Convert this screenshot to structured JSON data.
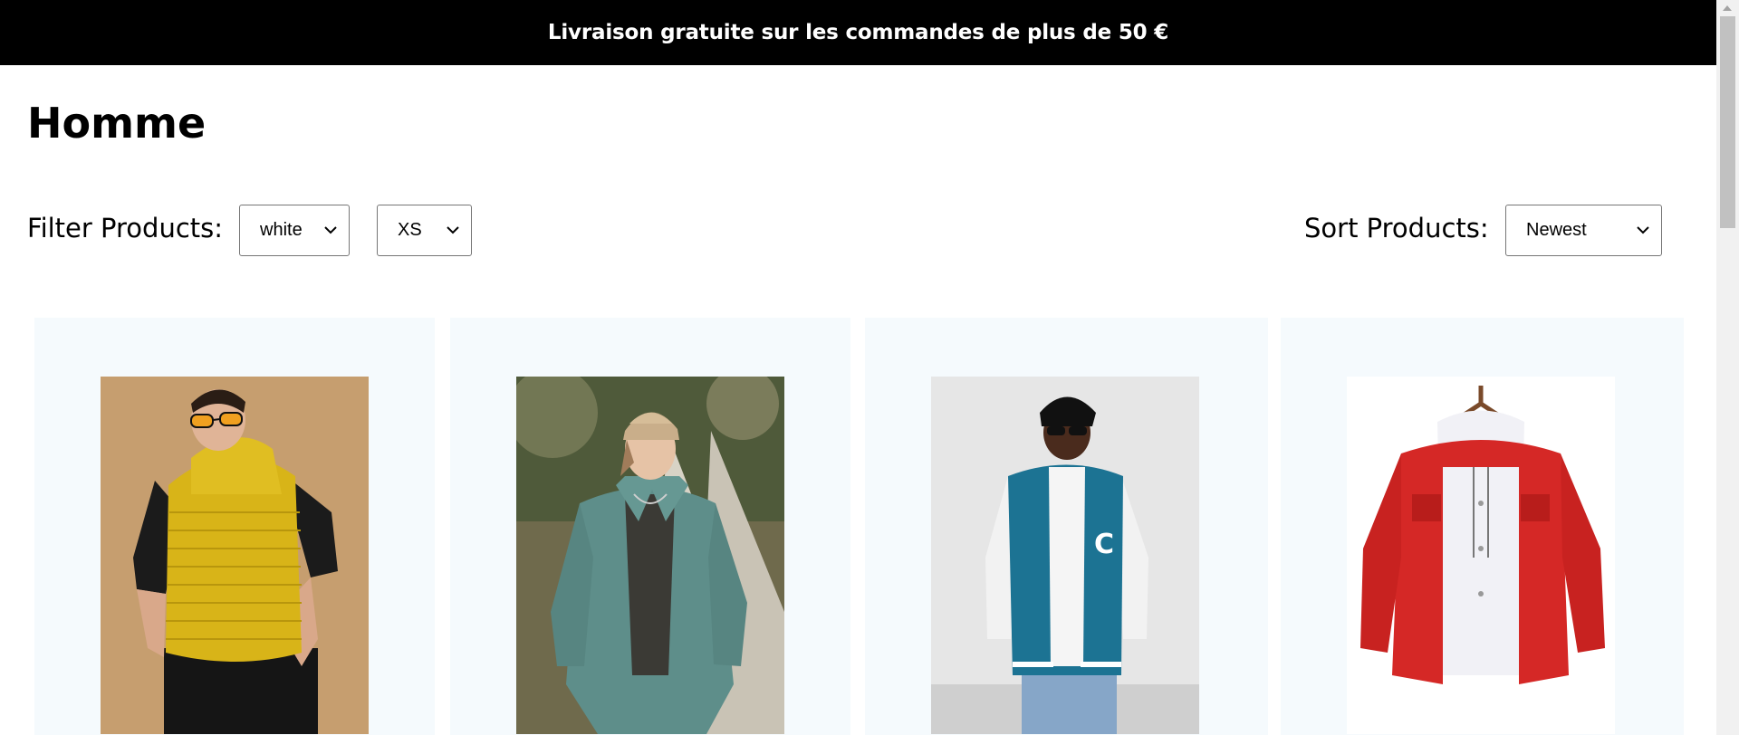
{
  "announcement": {
    "text": "Livraison gratuite sur les commandes de plus de 50 €"
  },
  "page": {
    "title": "Homme"
  },
  "filters": {
    "label": "Filter Products:",
    "color_selected": "white",
    "size_selected": "XS"
  },
  "sort": {
    "label": "Sort Products:",
    "selected": "Newest"
  },
  "products": [
    {
      "name": "yellow-quilted-hooded-vest",
      "icon": "product-photo-yellow-vest"
    },
    {
      "name": "teal-fleece-jacket",
      "icon": "product-photo-teal-jacket"
    },
    {
      "name": "blue-varsity-jacket",
      "icon": "product-photo-varsity-jacket"
    },
    {
      "name": "red-denim-jacket",
      "icon": "product-photo-red-jacket"
    }
  ],
  "colors": {
    "banner_bg": "#000000",
    "card_bg": "#f5fafd",
    "select_border": "#767676"
  }
}
